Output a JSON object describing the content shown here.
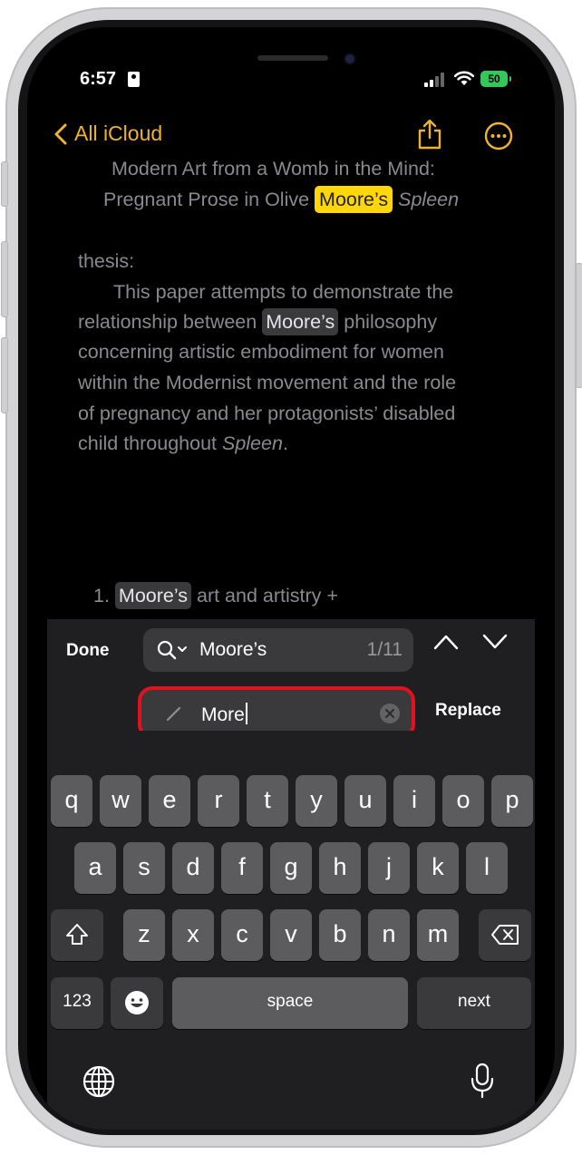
{
  "status_bar": {
    "time": "6:57",
    "battery": "50"
  },
  "nav": {
    "back_label": "All iCloud"
  },
  "document": {
    "title_line1": "Modern Art from a Womb in the Mind:",
    "title_line2_a": "Pregnant Prose in Olive ",
    "title_line2_highlight": "Moore’s",
    "title_line2_b": "Spleen",
    "thesis_label": "thesis:",
    "para_line1": "This paper attempts to demonstrate the",
    "para_line2_a": "relationship between ",
    "para_line2_highlight": "Moore’s",
    "para_line2_b": " philosophy",
    "para_line3": "concerning artistic embodiment for women",
    "para_line4": "within the Modernist movement and the role",
    "para_line5": "of pregnancy and her protagonists’ disabled",
    "para_line6_a": "child throughout ",
    "para_line6_italic": "Spleen",
    "para_line6_b": ".",
    "list_number": "1.",
    "list_highlight": "Moore’s",
    "list_text": " art and artistry +"
  },
  "find": {
    "done_label": "Done",
    "search_value": "Moore’s",
    "match_count": "1/11",
    "replace_value": "More",
    "replace_label": "Replace"
  },
  "keyboard": {
    "row1": [
      "q",
      "w",
      "e",
      "r",
      "t",
      "y",
      "u",
      "i",
      "o",
      "p"
    ],
    "row2": [
      "a",
      "s",
      "d",
      "f",
      "g",
      "h",
      "j",
      "k",
      "l"
    ],
    "row3": [
      "z",
      "x",
      "c",
      "v",
      "b",
      "n",
      "m"
    ],
    "numbers_label": "123",
    "space_label": "space",
    "next_label": "next"
  },
  "colors": {
    "accent": "#f0b32f",
    "highlight_current": "#ffd60a",
    "replace_border": "#e3101d"
  }
}
